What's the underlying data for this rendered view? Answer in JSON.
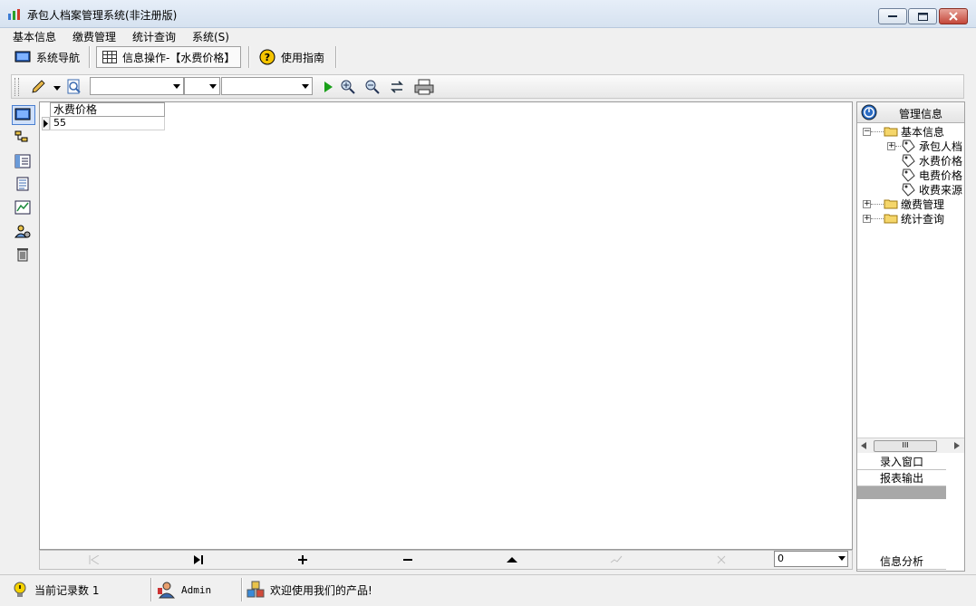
{
  "window": {
    "title": "承包人档案管理系统(非注册版)"
  },
  "menu": [
    "基本信息",
    "缴费管理",
    "统计查询",
    "系统(S)"
  ],
  "nav_tabs": [
    {
      "label": "系统导航",
      "icon": "monitor-icon"
    },
    {
      "label": "信息操作-【水费价格】",
      "icon": "grid-icon"
    },
    {
      "label": "使用指南",
      "icon": "help-icon"
    }
  ],
  "grid": {
    "columns": [
      "水费价格"
    ],
    "rows": [
      [
        "55"
      ]
    ]
  },
  "navigator": {
    "record_value": "0"
  },
  "right_panel": {
    "title": "管理信息",
    "tree": [
      {
        "label": "基本信息",
        "level": 0,
        "expander": "−"
      },
      {
        "label": "承包人档",
        "level": 1,
        "expander": "+"
      },
      {
        "label": "水费价格",
        "level": 1,
        "expander": ""
      },
      {
        "label": "电费价格",
        "level": 1,
        "expander": ""
      },
      {
        "label": "收费来源",
        "level": 1,
        "expander": ""
      },
      {
        "label": "缴费管理",
        "level": 0,
        "expander": "+"
      },
      {
        "label": "统计查询",
        "level": 0,
        "expander": "+"
      }
    ],
    "buttons": [
      "录入窗口",
      "报表输出"
    ],
    "bottom_label": "信息分析"
  },
  "status": {
    "record_count": "当前记录数 1",
    "user": "Admin",
    "welcome": "欢迎使用我们的产品!"
  },
  "colors": {
    "titlebar": "#dbe6f3",
    "close": "#c4473a",
    "accent_green": "#1aa01a"
  }
}
